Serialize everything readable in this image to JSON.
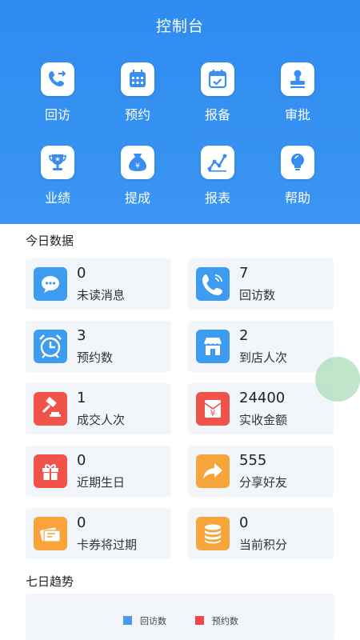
{
  "header": {
    "title": "控制台"
  },
  "menu": [
    {
      "label": "回访",
      "icon": "phone-callback-icon"
    },
    {
      "label": "预约",
      "icon": "calendar-icon"
    },
    {
      "label": "报备",
      "icon": "calendar-check-icon"
    },
    {
      "label": "审批",
      "icon": "stamp-icon"
    },
    {
      "label": "业绩",
      "icon": "trophy-icon"
    },
    {
      "label": "提成",
      "icon": "money-bag-icon"
    },
    {
      "label": "报表",
      "icon": "line-chart-icon"
    },
    {
      "label": "帮助",
      "icon": "lightbulb-icon"
    }
  ],
  "today": {
    "title": "今日数据",
    "cards": [
      {
        "value": "0",
        "label": "未读消息",
        "icon": "chat-bubble-icon",
        "color": "#3d9cf0"
      },
      {
        "value": "7",
        "label": "回访数",
        "icon": "phone-icon",
        "color": "#3d9cf0"
      },
      {
        "value": "3",
        "label": "预约数",
        "icon": "alarm-clock-icon",
        "color": "#3d9cf0"
      },
      {
        "value": "2",
        "label": "到店人次",
        "icon": "storefront-icon",
        "color": "#3d9cf0"
      },
      {
        "value": "1",
        "label": "成交人次",
        "icon": "gavel-icon",
        "color": "#f0534a"
      },
      {
        "value": "24400",
        "label": "实收金额",
        "icon": "yen-icon",
        "color": "#f0534a"
      },
      {
        "value": "0",
        "label": "近期生日",
        "icon": "gift-icon",
        "color": "#f0534a"
      },
      {
        "value": "555",
        "label": "分享好友",
        "icon": "share-arrow-icon",
        "color": "#f7a43a"
      },
      {
        "value": "0",
        "label": "卡券将过期",
        "icon": "ticket-icon",
        "color": "#f7a43a"
      },
      {
        "value": "0",
        "label": "当前积分",
        "icon": "coin-stack-icon",
        "color": "#f7a43a"
      }
    ]
  },
  "trend": {
    "title": "七日趋势",
    "legend": [
      {
        "label": "回访数",
        "color": "#4a9bf0"
      },
      {
        "label": "预约数",
        "color": "#f04848"
      }
    ]
  }
}
